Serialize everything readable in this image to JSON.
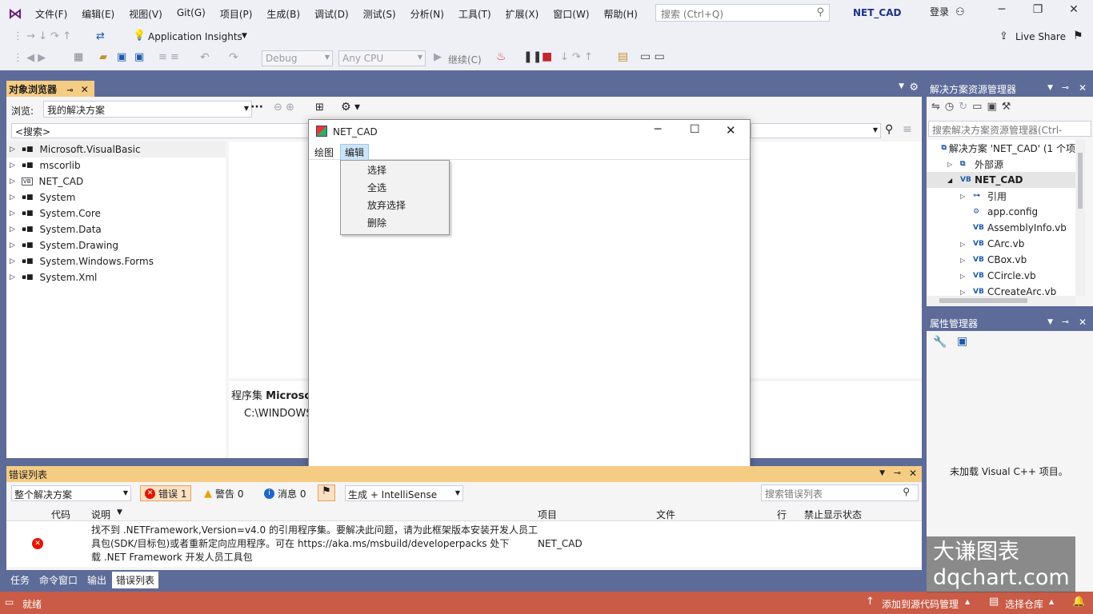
{
  "menu": [
    "文件(F)",
    "编辑(E)",
    "视图(V)",
    "Git(G)",
    "项目(P)",
    "生成(B)",
    "调试(D)",
    "测试(S)",
    "分析(N)",
    "工具(T)",
    "扩展(X)",
    "窗口(W)",
    "帮助(H)"
  ],
  "search": {
    "placeholder": "搜索 (Ctrl+Q)"
  },
  "project_name": "NET_CAD",
  "login": "登录",
  "toolbar": {
    "app_insights": "Application Insights",
    "live_share": "Live Share",
    "config": "Debug",
    "platform": "Any CPU",
    "continue": "继续(C)"
  },
  "object_browser": {
    "title": "对象浏览器",
    "browse_label": "浏览:",
    "browse_value": "我的解决方案",
    "search": "<搜索>",
    "tree": [
      "Microsoft.VisualBasic",
      "mscorlib",
      "NET_CAD",
      "System",
      "System.Core",
      "System.Data",
      "System.Drawing",
      "System.Windows.Forms",
      "System.Xml"
    ],
    "desc_prefix": "程序集 ",
    "desc_name": "Microsof",
    "desc_path": "C:\\WINDOWS"
  },
  "dialog": {
    "title": "NET_CAD",
    "menu": [
      "绘图",
      "编辑"
    ],
    "context_menu": [
      "选择",
      "全选",
      "放弃选择",
      "删除"
    ]
  },
  "error_list": {
    "title": "错误列表",
    "scope": "整个解决方案",
    "errors": "错误 1",
    "warnings": "警告 0",
    "messages": "消息 0",
    "build_filter": "生成 + IntelliSense",
    "search_placeholder": "搜索错误列表",
    "columns": [
      "代码",
      "说明",
      "项目",
      "文件",
      "行",
      "禁止显示状态"
    ],
    "rows": [
      {
        "code": "",
        "desc_line1": "找不到 .NETFramework,Version=v4.0 的引用程序集。要解决此问题，请为此框架版本安装开发人员工",
        "desc_line2": "具包(SDK/目标包)或者重新定向应用程序。可在 https://aka.ms/msbuild/developerpacks 处下",
        "desc_line3": "载 .NET Framework 开发人员工具包",
        "project": "NET_CAD",
        "file": "",
        "line": "",
        "suppression": ""
      }
    ],
    "tabs": [
      "任务",
      "命令窗口",
      "输出",
      "错误列表"
    ]
  },
  "solution_explorer": {
    "title": "解决方案资源管理器",
    "search_placeholder": "搜索解决方案资源管理器(Ctrl-",
    "items": [
      {
        "label": "解决方案 'NET_CAD' (1 个项",
        "icon": "solution-icon"
      },
      {
        "label": "外部源",
        "icon": "external-icon"
      },
      {
        "label": "NET_CAD",
        "icon": "vb-project-icon"
      },
      {
        "label": "引用",
        "icon": "references-icon"
      },
      {
        "label": "app.config",
        "icon": "config-icon"
      },
      {
        "label": "AssemblyInfo.vb",
        "icon": "vb-file-icon"
      },
      {
        "label": "CArc.vb",
        "icon": "vb-file-icon"
      },
      {
        "label": "CBox.vb",
        "icon": "vb-file-icon"
      },
      {
        "label": "CCircle.vb",
        "icon": "vb-file-icon"
      },
      {
        "label": "CCreateArc.vb",
        "icon": "vb-file-icon"
      }
    ]
  },
  "property_manager": {
    "title": "属性管理器",
    "message": "未加载 Visual C++ 项目。"
  },
  "statusbar": {
    "ready": "就绪",
    "source_control": "添加到源代码管理",
    "repo": "选择仓库"
  },
  "watermark": {
    "line1": "大谦图表",
    "line2": "dqchart.com"
  },
  "colors": {
    "accent": "#5d6b99",
    "tab_active": "#f5cc84",
    "status": "#ca5b46",
    "error": "#e51400"
  }
}
